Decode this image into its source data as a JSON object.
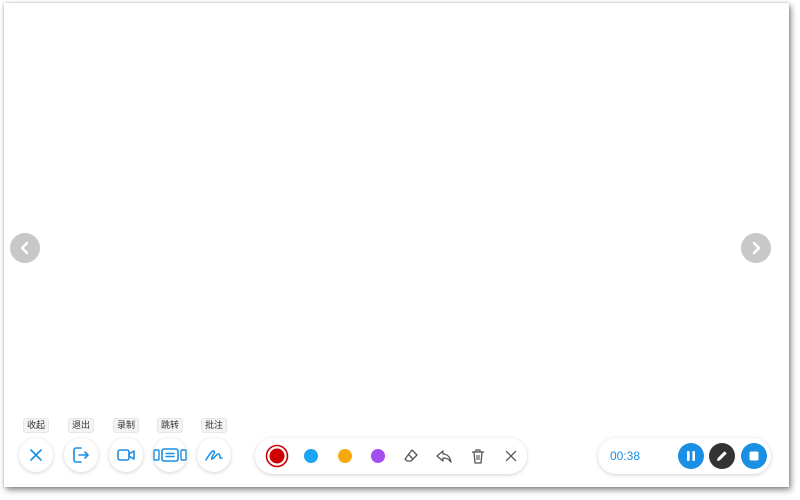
{
  "toolbar": {
    "items": [
      {
        "label": "收起",
        "icon": "close-icon"
      },
      {
        "label": "退出",
        "icon": "exit-icon"
      },
      {
        "label": "录制",
        "icon": "video-camera-icon"
      },
      {
        "label": "跳转",
        "icon": "slides-jump-icon"
      },
      {
        "label": "批注",
        "icon": "annotate-scribble-icon"
      }
    ]
  },
  "pen_bar": {
    "colors": {
      "red": "#cc0000",
      "blue": "#1aa4f2",
      "orange": "#f5a80f",
      "purple": "#a34ff0"
    },
    "tools": [
      "eraser-icon",
      "undo-icon",
      "trash-icon",
      "close-icon"
    ]
  },
  "recorder": {
    "time": "00:38",
    "accent": "#1a8fe3",
    "pen_color": "#333333"
  },
  "navigation": {
    "prev_icon": "chevron-left-icon",
    "next_icon": "chevron-right-icon"
  }
}
